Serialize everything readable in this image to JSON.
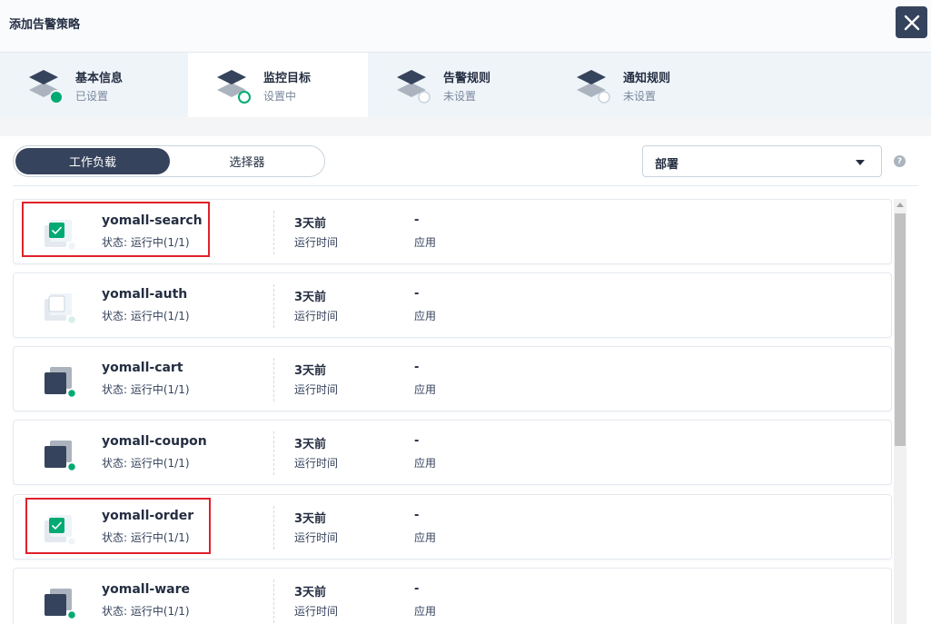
{
  "dialog": {
    "title": "添加告警策略"
  },
  "steps": [
    {
      "title": "基本信息",
      "subtitle": "已设置",
      "state": "done"
    },
    {
      "title": "监控目标",
      "subtitle": "设置中",
      "state": "active"
    },
    {
      "title": "告警规则",
      "subtitle": "未设置",
      "state": "pending"
    },
    {
      "title": "通知规则",
      "subtitle": "未设置",
      "state": "pending"
    }
  ],
  "toolbar": {
    "tabs": [
      {
        "label": "工作负载",
        "selected": true
      },
      {
        "label": "选择器",
        "selected": false
      }
    ],
    "select_value": "部署",
    "help_symbol": "?"
  },
  "workloads": [
    {
      "name": "yomall-search",
      "status": "状态: 运行中(1/1)",
      "time": "3天前",
      "time_label": "运行时间",
      "app": "-",
      "app_label": "应用",
      "checked": true
    },
    {
      "name": "yomall-auth",
      "status": "状态: 运行中(1/1)",
      "time": "3天前",
      "time_label": "运行时间",
      "app": "-",
      "app_label": "应用",
      "checked": false,
      "hover": true
    },
    {
      "name": "yomall-cart",
      "status": "状态: 运行中(1/1)",
      "time": "3天前",
      "time_label": "运行时间",
      "app": "-",
      "app_label": "应用",
      "checked": false
    },
    {
      "name": "yomall-coupon",
      "status": "状态: 运行中(1/1)",
      "time": "3天前",
      "time_label": "运行时间",
      "app": "-",
      "app_label": "应用",
      "checked": false
    },
    {
      "name": "yomall-order",
      "status": "状态: 运行中(1/1)",
      "time": "3天前",
      "time_label": "运行时间",
      "app": "-",
      "app_label": "应用",
      "checked": true
    },
    {
      "name": "yomall-ware",
      "status": "状态: 运行中(1/1)",
      "time": "3天前",
      "time_label": "运行时间",
      "app": "-",
      "app_label": "应用",
      "checked": false
    }
  ],
  "colors": {
    "accent": "#00aa72",
    "dark": "#36435c",
    "highlight": "#e0202b"
  }
}
